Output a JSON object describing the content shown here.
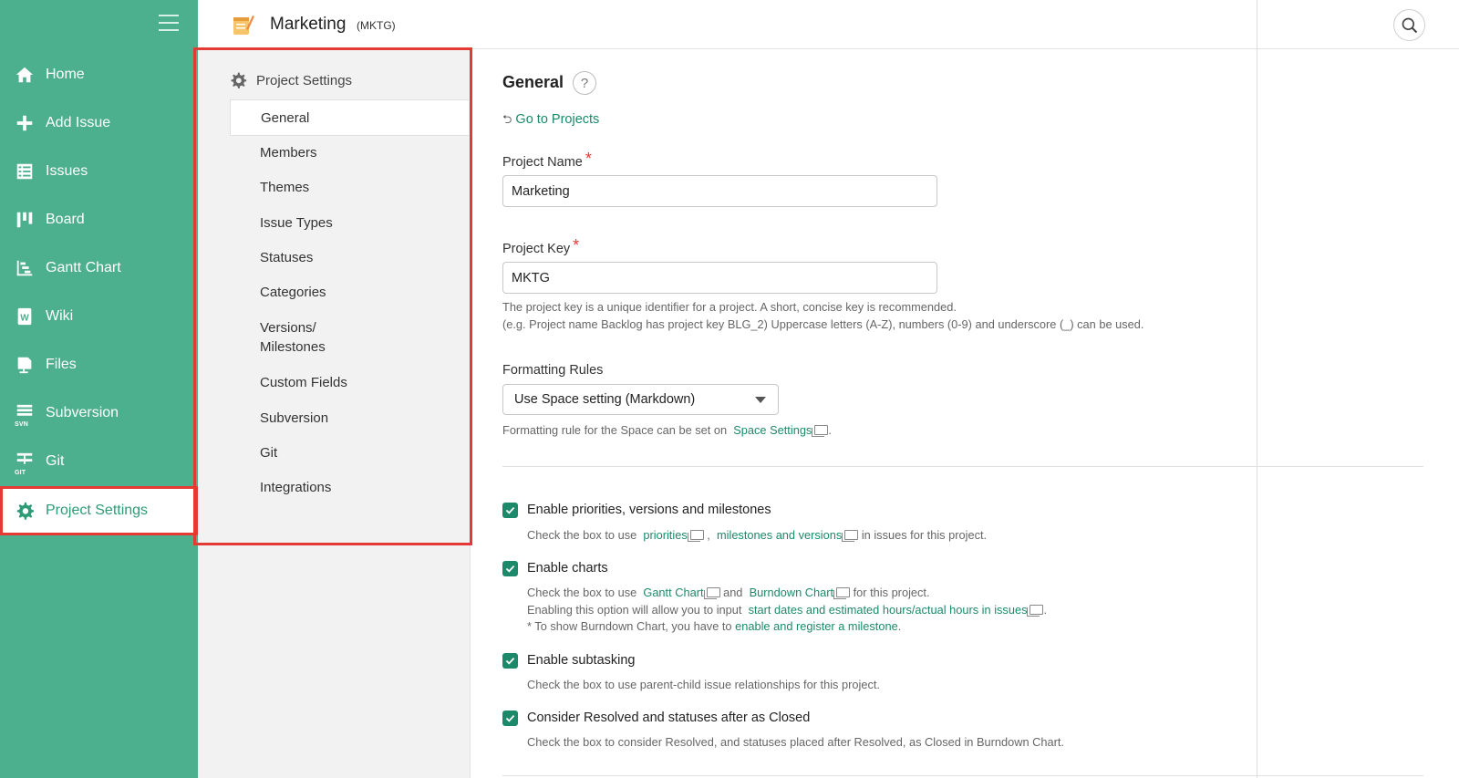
{
  "sidebar": {
    "items": [
      {
        "label": "Home",
        "icon": "home-icon"
      },
      {
        "label": "Add Issue",
        "icon": "plus-icon"
      },
      {
        "label": "Issues",
        "icon": "list-icon"
      },
      {
        "label": "Board",
        "icon": "board-icon"
      },
      {
        "label": "Gantt Chart",
        "icon": "gantt-icon"
      },
      {
        "label": "Wiki",
        "icon": "wiki-icon"
      },
      {
        "label": "Files",
        "icon": "files-icon"
      },
      {
        "label": "Subversion",
        "icon": "subversion-icon",
        "sub": "SVN"
      },
      {
        "label": "Git",
        "icon": "git-icon",
        "sub": "GIT"
      },
      {
        "label": "Project Settings",
        "icon": "gear-icon"
      }
    ]
  },
  "header": {
    "project_name": "Marketing",
    "project_key": "(MKTG)"
  },
  "settings_nav": {
    "title": "Project Settings",
    "items": [
      "General",
      "Members",
      "Themes",
      "Issue Types",
      "Statuses",
      "Categories",
      "Versions/",
      "Milestones",
      "Custom Fields",
      "Subversion",
      "Git",
      "Integrations"
    ]
  },
  "main": {
    "title": "General",
    "help": "?",
    "go_to_projects": "Go to Projects",
    "project_name_label": "Project Name",
    "project_name_value": "Marketing",
    "required_mark": "*",
    "project_key_label": "Project Key",
    "project_key_value": "MKTG",
    "key_help_1": "The project key is a unique identifier for a project. A short, concise key is recommended.",
    "key_help_2": "(e.g. Project name Backlog has project key BLG_2) Uppercase letters (A-Z), numbers (0-9) and underscore (_) can be used.",
    "formatting_label": "Formatting Rules",
    "formatting_value": "Use Space setting (Markdown)",
    "formatting_help_prefix": "Formatting rule for the Space can be set on",
    "formatting_help_link": "Space Settings",
    "formatting_help_suffix": ".",
    "options": {
      "priorities": {
        "label": "Enable priorities, versions and milestones",
        "help_prefix": "Check the box to use",
        "link1": "priorities",
        "sep": ",",
        "link2": "milestones and versions",
        "help_suffix": "in issues for this project."
      },
      "charts": {
        "label": "Enable charts",
        "help_prefix": "Check the box to use",
        "link1": "Gantt Chart",
        "and": "and",
        "link2": "Burndown Chart",
        "help_suffix": "for this project.",
        "line2_prefix": "Enabling this option will allow you to input",
        "line2_link": "start dates and estimated hours/actual hours in issues",
        "line2_suffix": ".",
        "line3_prefix": "* To show Burndown Chart, you have to",
        "line3_link": "enable and register a milestone",
        "line3_suffix": "."
      },
      "subtasking": {
        "label": "Enable subtasking",
        "help": "Check the box to use parent-child issue relationships for this project."
      },
      "resolved": {
        "label": "Consider Resolved and statuses after as Closed",
        "help": "Check the box to consider Resolved, and statuses placed after Resolved, as Closed in Burndown Chart."
      }
    }
  },
  "colors": {
    "sidebar": "#4caf8e",
    "accent": "#1c8a6a",
    "highlight_border": "#e53935"
  }
}
